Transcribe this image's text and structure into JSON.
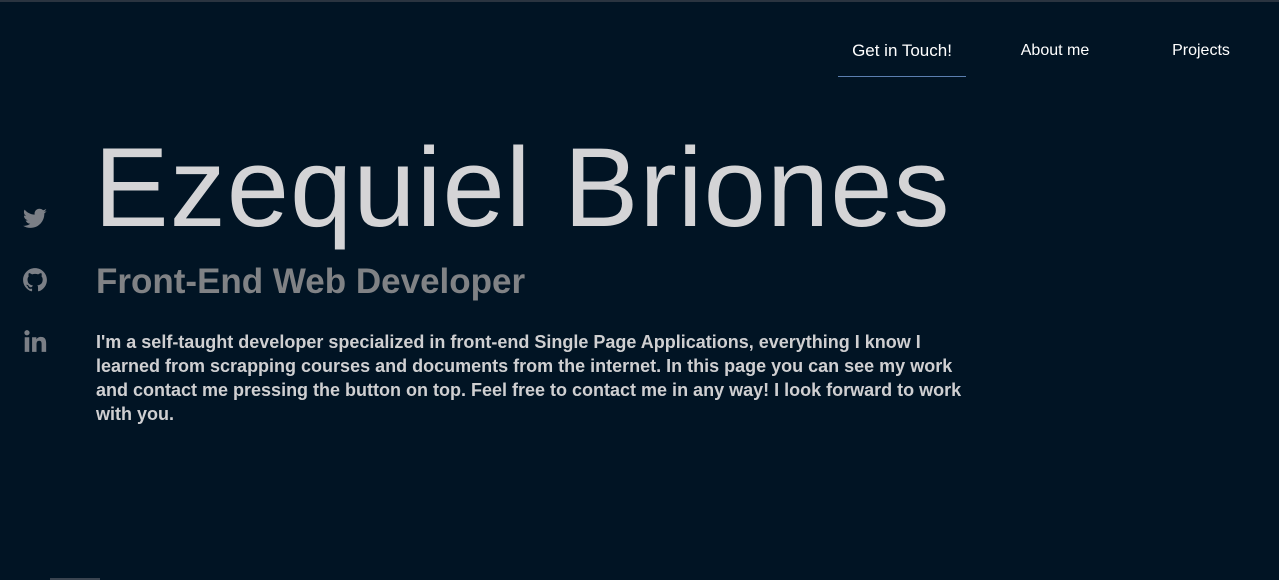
{
  "nav": {
    "contact_label": "Get in Touch!",
    "about_label": "About me",
    "projects_label": "Projects"
  },
  "socials": [
    {
      "icon": "twitter-icon"
    },
    {
      "icon": "github-icon"
    },
    {
      "icon": "linkedin-icon"
    }
  ],
  "hero": {
    "name": "Ezequiel Briones",
    "role": "Front-End Web Developer",
    "bio": "I'm a self-taught developer specialized in front-end Single Page Applications, everything I know I learned from scrapping courses and documents from the internet. In this page you can see my work and contact me pressing the button on top. Feel free to contact me in any way! I look forward to work with you."
  },
  "colors": {
    "background": "#011424",
    "name": "#d4d4d6",
    "role": "#808285",
    "bio": "#cfcfd1",
    "icon": "#7b7f86",
    "nav_underline": "#5b7fb0"
  }
}
